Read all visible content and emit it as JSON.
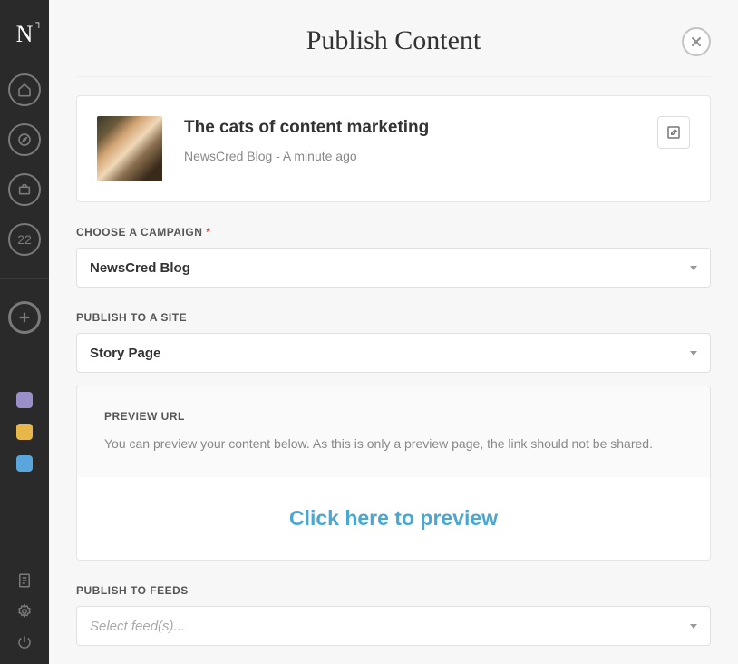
{
  "header": {
    "title": "Publish Content"
  },
  "sidebar": {
    "logo": "N",
    "badge_count": "22",
    "swatches": [
      "#9b8fc7",
      "#e8b74a",
      "#5aa5dc"
    ]
  },
  "content": {
    "title": "The cats of content marketing",
    "meta": "NewsCred Blog - A minute ago"
  },
  "campaign": {
    "label": "CHOOSE A CAMPAIGN",
    "value": "NewsCred Blog"
  },
  "site": {
    "label": "PUBLISH TO A SITE",
    "value": "Story Page"
  },
  "preview": {
    "label": "PREVIEW URL",
    "description": "You can preview your content below. As this is only a preview page, the link should not be shared.",
    "link_text": "Click here to preview"
  },
  "feeds": {
    "label": "PUBLISH TO FEEDS",
    "placeholder": "Select feed(s)..."
  }
}
